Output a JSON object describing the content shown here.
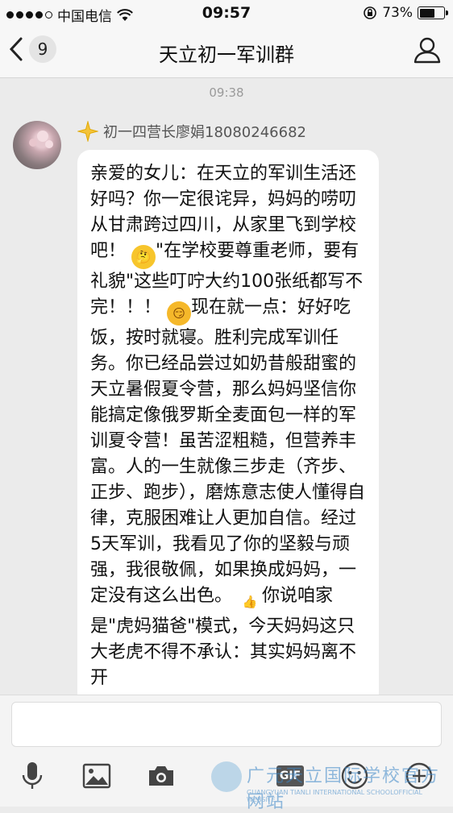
{
  "status_bar": {
    "carrier": "中国电信",
    "time": "09:57",
    "battery_percent": "73%",
    "battery_level": 0.73
  },
  "nav": {
    "back_count": "9",
    "title": "天立初一军训群"
  },
  "chat": {
    "timestamp": "09:38",
    "sender_name": "初一四营长廖娟18080246682",
    "message": {
      "part1": "亲爱的女儿：在天立的军训生活还好吗？你一定很诧异，妈妈的唠叨从甘肃跨过四川，从家里飞到学校吧！",
      "part2": "\"在学校要尊重老师，要有礼貌\"这些叮咛大约100张纸都写不完！！！",
      "part3": "现在就一点：好好吃饭，按时就寝。胜利完成军训任务。你已经品尝过如奶昔般甜蜜的天立暑假夏令营，那么妈妈坚信你能搞定像俄罗斯全麦面包一样的军训夏令营！虽苦涩粗糙，但营养丰富。人的一生就像三步走（齐步、正步、跑步），磨炼意志使人懂得自律，克服困难让人更加自信。经过5天军训，我看见了你的坚毅与顽强，我很敬佩，如果换成妈妈，一定没有这么出色。",
      "part4": "你说咱家是\"虎妈猫爸\"模式，今天妈妈这只大老虎不得不承认：其实妈妈离不开"
    }
  },
  "watermark": {
    "name_cn": "广元天立国际学校官方网站",
    "name_en": "GUANGYUAN TIANLI INTERNATIONAL SCHOOLOFFICIAL WEBSITE"
  },
  "toolbar": {
    "gif_label": "GIF"
  },
  "colors": {
    "background": "#ebebeb",
    "bubble": "#ffffff",
    "bar": "#f7f7f7"
  }
}
